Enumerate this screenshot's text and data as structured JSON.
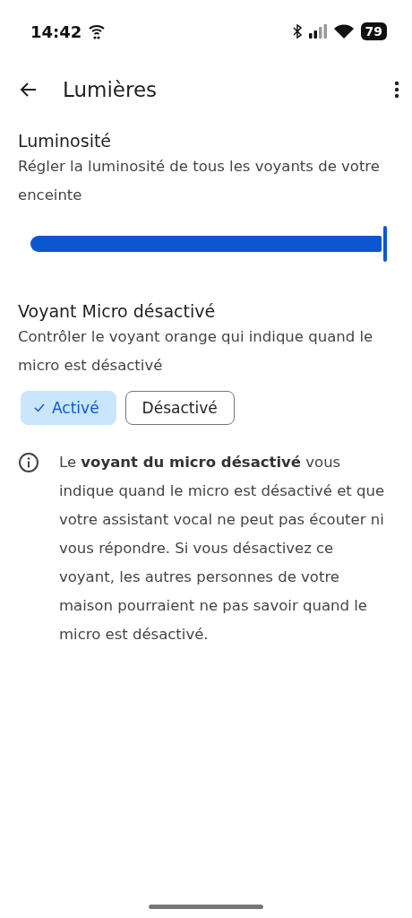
{
  "status_bar": {
    "time": "14:42",
    "battery": "79"
  },
  "header": {
    "title": "Lumières"
  },
  "brightness": {
    "title": "Luminosité",
    "description": "Régler la luminosité de tous les voyants de votre enceinte",
    "level": 1.0
  },
  "mic_light": {
    "title": "Voyant Micro désactivé",
    "description": "Contrôler le voyant orange qui indique quand le micro est désactivé",
    "options": [
      {
        "label": "Activé",
        "selected": true
      },
      {
        "label": "Désactivé",
        "selected": false
      }
    ]
  },
  "info": {
    "text": "Le **voyant du micro désactivé** vous indique quand le micro est désactivé et que votre assistant vocal ne peut pas écouter ni vous répondre. Si vous désactivez ce voyant, les autres personnes de votre maison pourraient ne pas savoir quand le micro est désactivé."
  }
}
